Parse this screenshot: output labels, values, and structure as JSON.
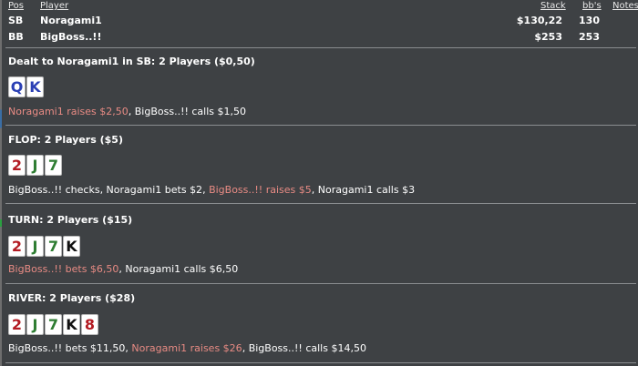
{
  "header": {
    "col_pos": "Pos",
    "col_player": "Player",
    "col_stack": "Stack",
    "col_bbs": "bb's",
    "col_notes": "Notes"
  },
  "players": [
    {
      "pos": "SB",
      "name": "Noragami1",
      "stack": "$130,22",
      "bbs": "130"
    },
    {
      "pos": "BB",
      "name": "BigBoss..!!",
      "stack": "$253",
      "bbs": "253"
    }
  ],
  "colors": {
    "background": "#3e4144",
    "highlight_action": "#e88b84",
    "spade": "#111111",
    "heart": "#b31b22",
    "diamond": "#2b40b5",
    "club": "#2e7d32"
  },
  "streets": {
    "preflop": {
      "title": "Dealt to Noragami1 in SB: 2 Players ($0,50)",
      "cards": [
        {
          "rank": "Q",
          "suit": "diamonds"
        },
        {
          "rank": "K",
          "suit": "diamonds"
        }
      ],
      "a1": "Noragami1 raises $2,50",
      "s1": ", ",
      "a2": "BigBoss..!! calls $1,50"
    },
    "flop": {
      "title": "FLOP: 2 Players ($5)",
      "cards": [
        {
          "rank": "2",
          "suit": "hearts"
        },
        {
          "rank": "J",
          "suit": "clubs"
        },
        {
          "rank": "7",
          "suit": "clubs"
        }
      ],
      "a1": "BigBoss..!! checks, Noragami1 bets $2",
      "s1": ", ",
      "a2": "BigBoss..!! raises $5",
      "s2": ", ",
      "a3": "Noragami1 calls $3"
    },
    "turn": {
      "title": "TURN: 2 Players ($15)",
      "cards": [
        {
          "rank": "2",
          "suit": "hearts"
        },
        {
          "rank": "J",
          "suit": "clubs"
        },
        {
          "rank": "7",
          "suit": "clubs"
        },
        {
          "rank": "K",
          "suit": "spades"
        }
      ],
      "a1": "BigBoss..!! bets $6,50",
      "s1": ", ",
      "a2": "Noragami1 calls $6,50"
    },
    "river": {
      "title": "RIVER: 2 Players ($28)",
      "cards": [
        {
          "rank": "2",
          "suit": "hearts"
        },
        {
          "rank": "J",
          "suit": "clubs"
        },
        {
          "rank": "7",
          "suit": "clubs"
        },
        {
          "rank": "K",
          "suit": "spades"
        },
        {
          "rank": "8",
          "suit": "hearts"
        }
      ],
      "a1": "BigBoss..!! bets $11,50",
      "s1": ", ",
      "a2": "Noragami1 raises $26",
      "s2": ", ",
      "a3": "BigBoss..!! calls $14,50"
    }
  }
}
